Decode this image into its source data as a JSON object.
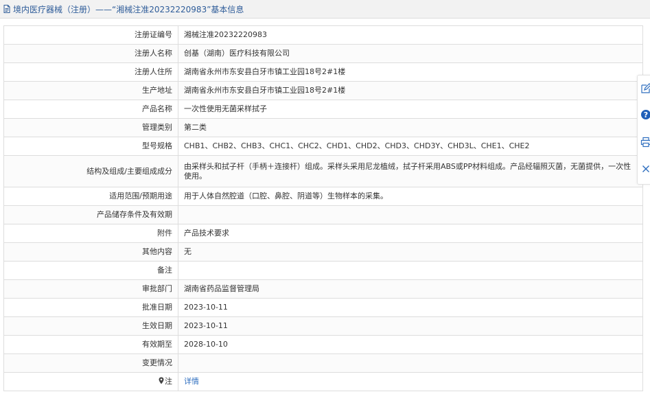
{
  "header": {
    "title": "境内医疗器械（注册）——“湘械注准20232220983”基本信息",
    "icon": "document-icon"
  },
  "rows": [
    {
      "key": "reg_no",
      "label": "注册证编号",
      "value": "湘械注准20232220983"
    },
    {
      "key": "registrant",
      "label": "注册人名称",
      "value": "创基（湖南）医疗科技有限公司"
    },
    {
      "key": "registrant_address",
      "label": "注册人住所",
      "value": "湖南省永州市东安县白牙市镇工业园18号2#1楼"
    },
    {
      "key": "production_address",
      "label": "生产地址",
      "value": "湖南省永州市东安县白牙市镇工业园18号2#1楼"
    },
    {
      "key": "product_name",
      "label": "产品名称",
      "value": "一次性使用无菌采样拭子"
    },
    {
      "key": "management_class",
      "label": "管理类别",
      "value": "第二类"
    },
    {
      "key": "models",
      "label": "型号规格",
      "value": "CHB1、CHB2、CHB3、CHC1、CHC2、CHD1、CHD2、CHD3、CHD3Y、CHD3L、CHE1、CHE2"
    },
    {
      "key": "structure",
      "label": "结构及组成/主要组成成分",
      "value": "由采样头和拭子杆（手柄＋连接杆）组成。采样头采用尼龙植绒，拭子杆采用ABS或PP材料组成。产品经辐照灭菌，无菌提供，一次性使用。"
    },
    {
      "key": "intended_use",
      "label": "适用范围/预期用途",
      "value": "用于人体自然腔道（口腔、鼻腔、阴道等）生物样本的采集。"
    },
    {
      "key": "storage",
      "label": "产品储存条件及有效期",
      "value": ""
    },
    {
      "key": "attachment",
      "label": "附件",
      "value": "产品技术要求"
    },
    {
      "key": "other",
      "label": "其他内容",
      "value": "无"
    },
    {
      "key": "remark",
      "label": "备注",
      "value": ""
    },
    {
      "key": "approval_dept",
      "label": "审批部门",
      "value": "湖南省药品监督管理局"
    },
    {
      "key": "approval_date",
      "label": "批准日期",
      "value": "2023-10-11"
    },
    {
      "key": "effective_date",
      "label": "生效日期",
      "value": "2023-10-11"
    },
    {
      "key": "expiry_date",
      "label": "有效期至",
      "value": "2028-10-10"
    },
    {
      "key": "change",
      "label": "变更情况",
      "value": ""
    },
    {
      "key": "note",
      "label": "注",
      "value": "详情"
    }
  ],
  "side_tools": [
    {
      "name": "edit-icon"
    },
    {
      "name": "help-icon"
    },
    {
      "name": "print-icon"
    },
    {
      "name": "close-icon"
    }
  ],
  "colors": {
    "title_text": "#2e5c99",
    "link": "#2e6ebf",
    "help_badge": "#1f5fb8"
  }
}
